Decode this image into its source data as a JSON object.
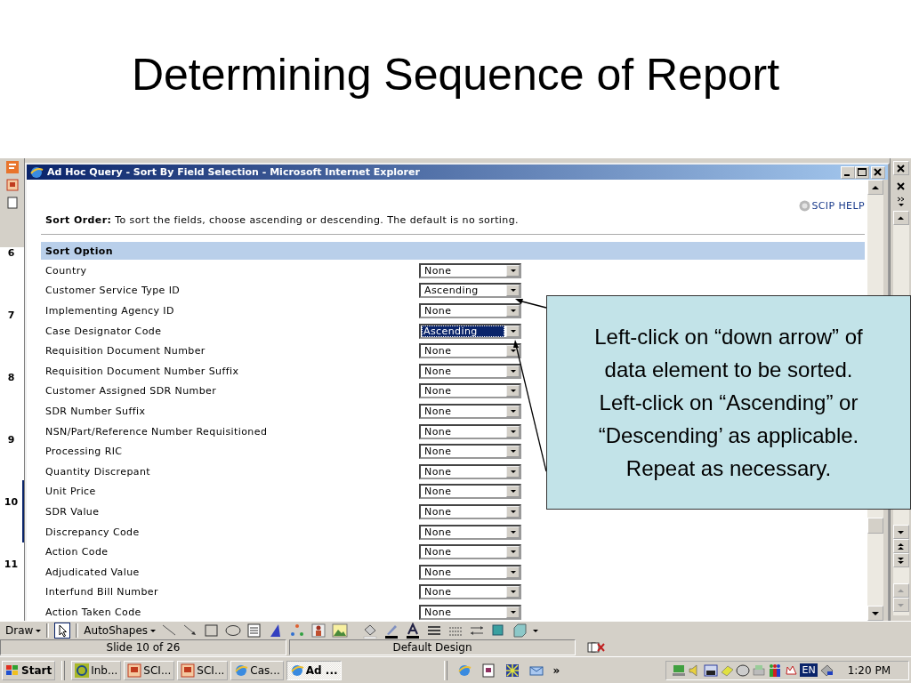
{
  "slide": {
    "title": "Determining Sequence of Report"
  },
  "slide_pane": {
    "slide_numbers": [
      {
        "number": "6",
        "selected": false
      },
      {
        "number": "7",
        "selected": false
      },
      {
        "number": "8",
        "selected": false
      },
      {
        "number": "9",
        "selected": false
      },
      {
        "number": "10",
        "selected": true
      },
      {
        "number": "11",
        "selected": false
      }
    ]
  },
  "browser_window": {
    "title": "Ad Hoc Query - Sort By Field Selection - Microsoft Internet Explorer",
    "help_link": "SCIP HELP",
    "instructions": "**Sort Order:** To sort the fields, choose ascending or descending. The default is no sorting.",
    "table_header": "Sort Option",
    "rows": [
      {
        "label": "Country",
        "value": "None",
        "focused": false
      },
      {
        "label": "Customer Service Type ID",
        "value": "Ascending",
        "focused": false
      },
      {
        "label": "Implementing Agency ID",
        "value": "None",
        "focused": false
      },
      {
        "label": "Case Designator Code",
        "value": "Ascending",
        "focused": true
      },
      {
        "label": "Requisition Document Number",
        "value": "None",
        "focused": false
      },
      {
        "label": "Requisition Document Number Suffix",
        "value": "None",
        "focused": false
      },
      {
        "label": "Customer Assigned SDR Number",
        "value": "None",
        "focused": false
      },
      {
        "label": "SDR Number Suffix",
        "value": "None",
        "focused": false
      },
      {
        "label": "NSN/Part/Reference Number Requisitioned",
        "value": "None",
        "focused": false
      },
      {
        "label": "Processing RIC",
        "value": "None",
        "focused": false
      },
      {
        "label": "Quantity Discrepant",
        "value": "None",
        "focused": false
      },
      {
        "label": "Unit Price",
        "value": "None",
        "focused": false
      },
      {
        "label": "SDR Value",
        "value": "None",
        "focused": false
      },
      {
        "label": "Discrepancy Code",
        "value": "None",
        "focused": false
      },
      {
        "label": "Action Code",
        "value": "None",
        "focused": false
      },
      {
        "label": "Adjudicated Value",
        "value": "None",
        "focused": false
      },
      {
        "label": "Interfund Bill Number",
        "value": "None",
        "focused": false
      },
      {
        "label": "Action Taken Code",
        "value": "None",
        "focused": false
      }
    ]
  },
  "callout": {
    "lines": [
      "Left-click on “down arrow” of",
      "data element to be sorted.",
      "Left-click on “Ascending” or",
      "“Descending’ as applicable.",
      "Repeat as necessary."
    ]
  },
  "drawing_toolbar": {
    "draw_menu": "Draw",
    "autoshapes_menu": "AutoShapes"
  },
  "status_bar": {
    "slide_position": "Slide 10 of 26",
    "design": "Default Design"
  },
  "taskbar": {
    "start": "Start",
    "buttons": [
      {
        "label": "Inb...",
        "kind": "mail",
        "selected": false
      },
      {
        "label": "SCI...",
        "kind": "slides",
        "selected": false
      },
      {
        "label": "SCI...",
        "kind": "slides",
        "selected": false
      },
      {
        "label": "Cas...",
        "kind": "browser",
        "selected": false
      },
      {
        "label": "Ad ...",
        "kind": "browser",
        "selected": true
      }
    ],
    "more": "»",
    "language": "EN",
    "clock": "1:20 PM"
  }
}
